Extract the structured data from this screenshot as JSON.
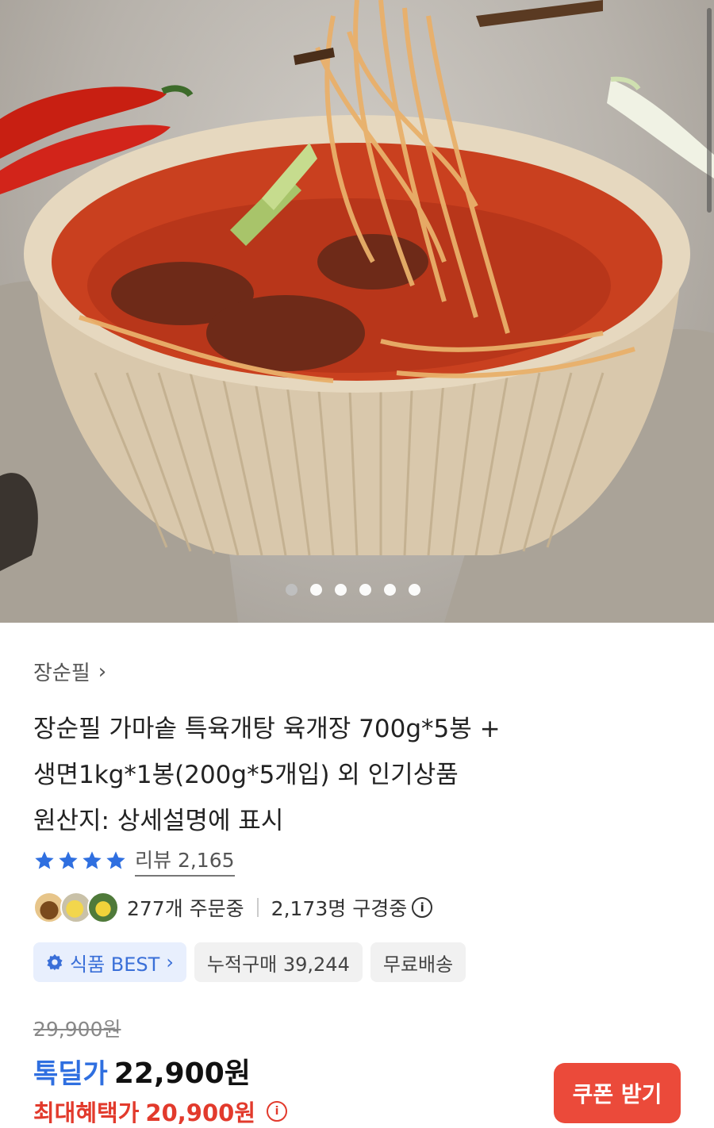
{
  "hero": {
    "dots_count": 6,
    "active_dot": 0
  },
  "product": {
    "brand": "장순필",
    "title_lines": [
      "장순필 가마솥 특육개탕 육개장 700g*5봉 +",
      "생면1kg*1봉(200g*5개입) 외 인기상품",
      "원산지: 상세설명에 표시"
    ],
    "rating_stars": 4,
    "review_label": "리뷰 2,165",
    "ordering": "277개 주문중",
    "browsing": "2,173명 구경중",
    "badges": {
      "best": "식품 BEST",
      "cumulative": "누적구매 39,244",
      "shipping": "무료배송"
    },
    "original_price": "29,900원",
    "deal_label": "톡딜가",
    "deal_price": "22,900원",
    "max_label": "최대혜택가",
    "max_price": "20,900원",
    "coupon_button": "쿠폰 받기"
  },
  "colors": {
    "accent_blue": "#2f6fe0",
    "accent_red": "#e23a2c",
    "coupon_bg": "#eb4a3a"
  }
}
